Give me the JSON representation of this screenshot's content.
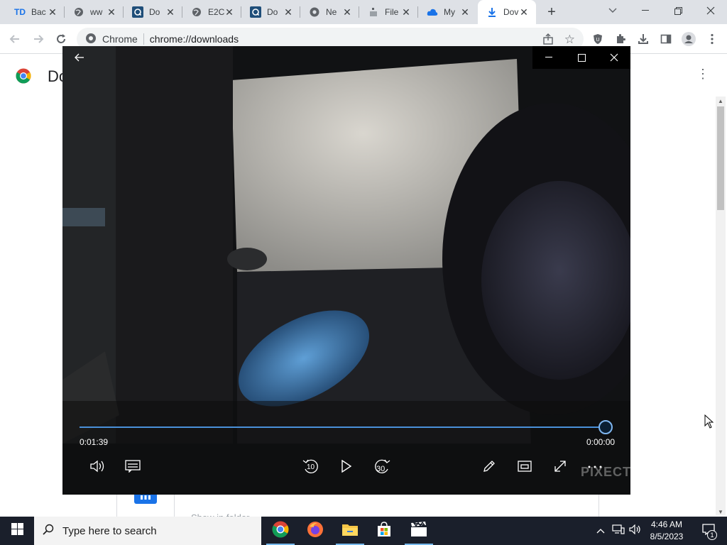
{
  "browser": {
    "tabs": [
      {
        "title": "Bac",
        "icon": "td-icon",
        "active": false
      },
      {
        "title": "ww",
        "icon": "globe-icon",
        "active": false
      },
      {
        "title": "Do",
        "icon": "q-app-icon",
        "active": false
      },
      {
        "title": "E2C",
        "icon": "globe-icon",
        "active": false
      },
      {
        "title": "Do",
        "icon": "q-app-icon",
        "active": false
      },
      {
        "title": "Ne",
        "icon": "chrome-icon",
        "active": false
      },
      {
        "title": "File",
        "icon": "file-icon",
        "active": false
      },
      {
        "title": "My",
        "icon": "cloud-icon",
        "active": false
      },
      {
        "title": "Dov",
        "icon": "download-icon",
        "active": true
      }
    ],
    "omnibox": {
      "site_chip": "Chrome",
      "url": "chrome://downloads"
    }
  },
  "page": {
    "title_visible": "Do",
    "card_link": "Show in folder"
  },
  "player": {
    "elapsed": "0:01:39",
    "remaining": "0:00:00",
    "progress": 1.0,
    "skip_back": "10",
    "skip_forward": "30",
    "watermark": "PIXECT",
    "colors": {
      "seek": "#4a90d9",
      "knob_ring": "#7fb6f0"
    }
  },
  "taskbar": {
    "search_placeholder": "Type here to search",
    "time": "4:46 AM",
    "date": "8/5/2023",
    "notification_count": "1"
  }
}
